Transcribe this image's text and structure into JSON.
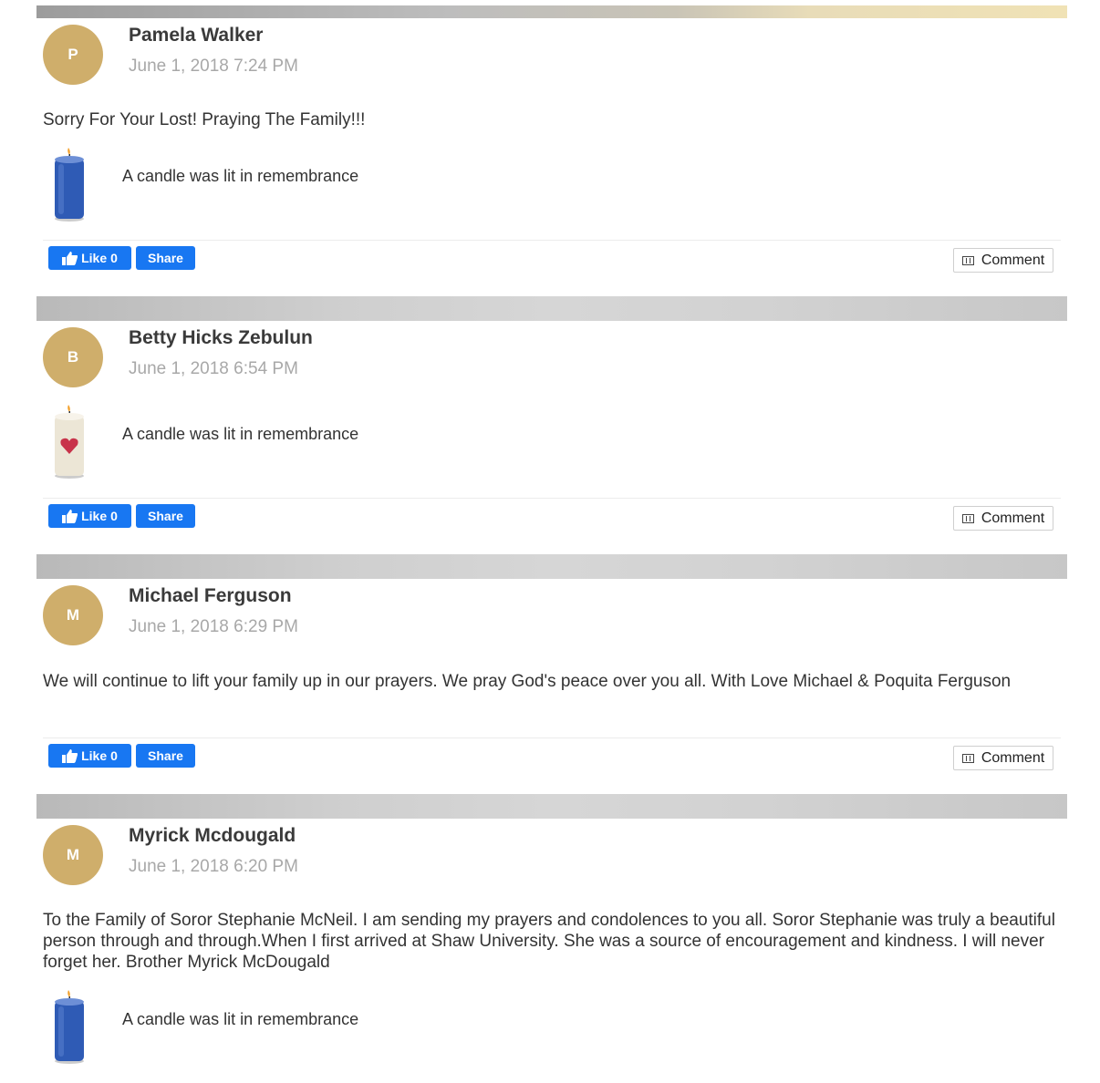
{
  "posts": [
    {
      "initial": "P",
      "name": "Pamela Walker",
      "date": "June 1, 2018 7:24 PM",
      "message": "Sorry For Your Lost! Praying The Family!!!",
      "candle": "A candle was lit in remembrance",
      "candle_icon": "blue-candle-icon"
    },
    {
      "initial": "B",
      "name": "Betty Hicks Zebulun",
      "date": "June 1, 2018 6:54 PM",
      "candle": "A candle was lit in remembrance",
      "candle_icon": "heart-candle-icon"
    },
    {
      "initial": "M",
      "name": "Michael Ferguson",
      "date": "June 1, 2018 6:29 PM",
      "message": "We will continue to lift your family up in our prayers. We pray God's peace over you all. With Love Michael & Poquita Ferguson"
    },
    {
      "initial": "M",
      "name": "Myrick Mcdougald",
      "date": "June 1, 2018 6:20 PM",
      "message": "To the Family of Soror Stephanie McNeil. I am sending my prayers and condolences to you all. Soror Stephanie was truly a beautiful person through and through.When I first arrived at Shaw University. She was a source of encouragement and kindness. I will never forget her. Brother Myrick McDougald",
      "candle": "A candle was lit in remembrance",
      "candle_icon": "blue-candle-icon"
    }
  ],
  "actions": {
    "like_label": "Like",
    "like_count": "0",
    "share_label": "Share",
    "comment_label": "Comment"
  },
  "colors": {
    "avatar": "#cfae6b",
    "facebook_blue": "#1877f2",
    "date_gray": "#a8a8a8"
  }
}
